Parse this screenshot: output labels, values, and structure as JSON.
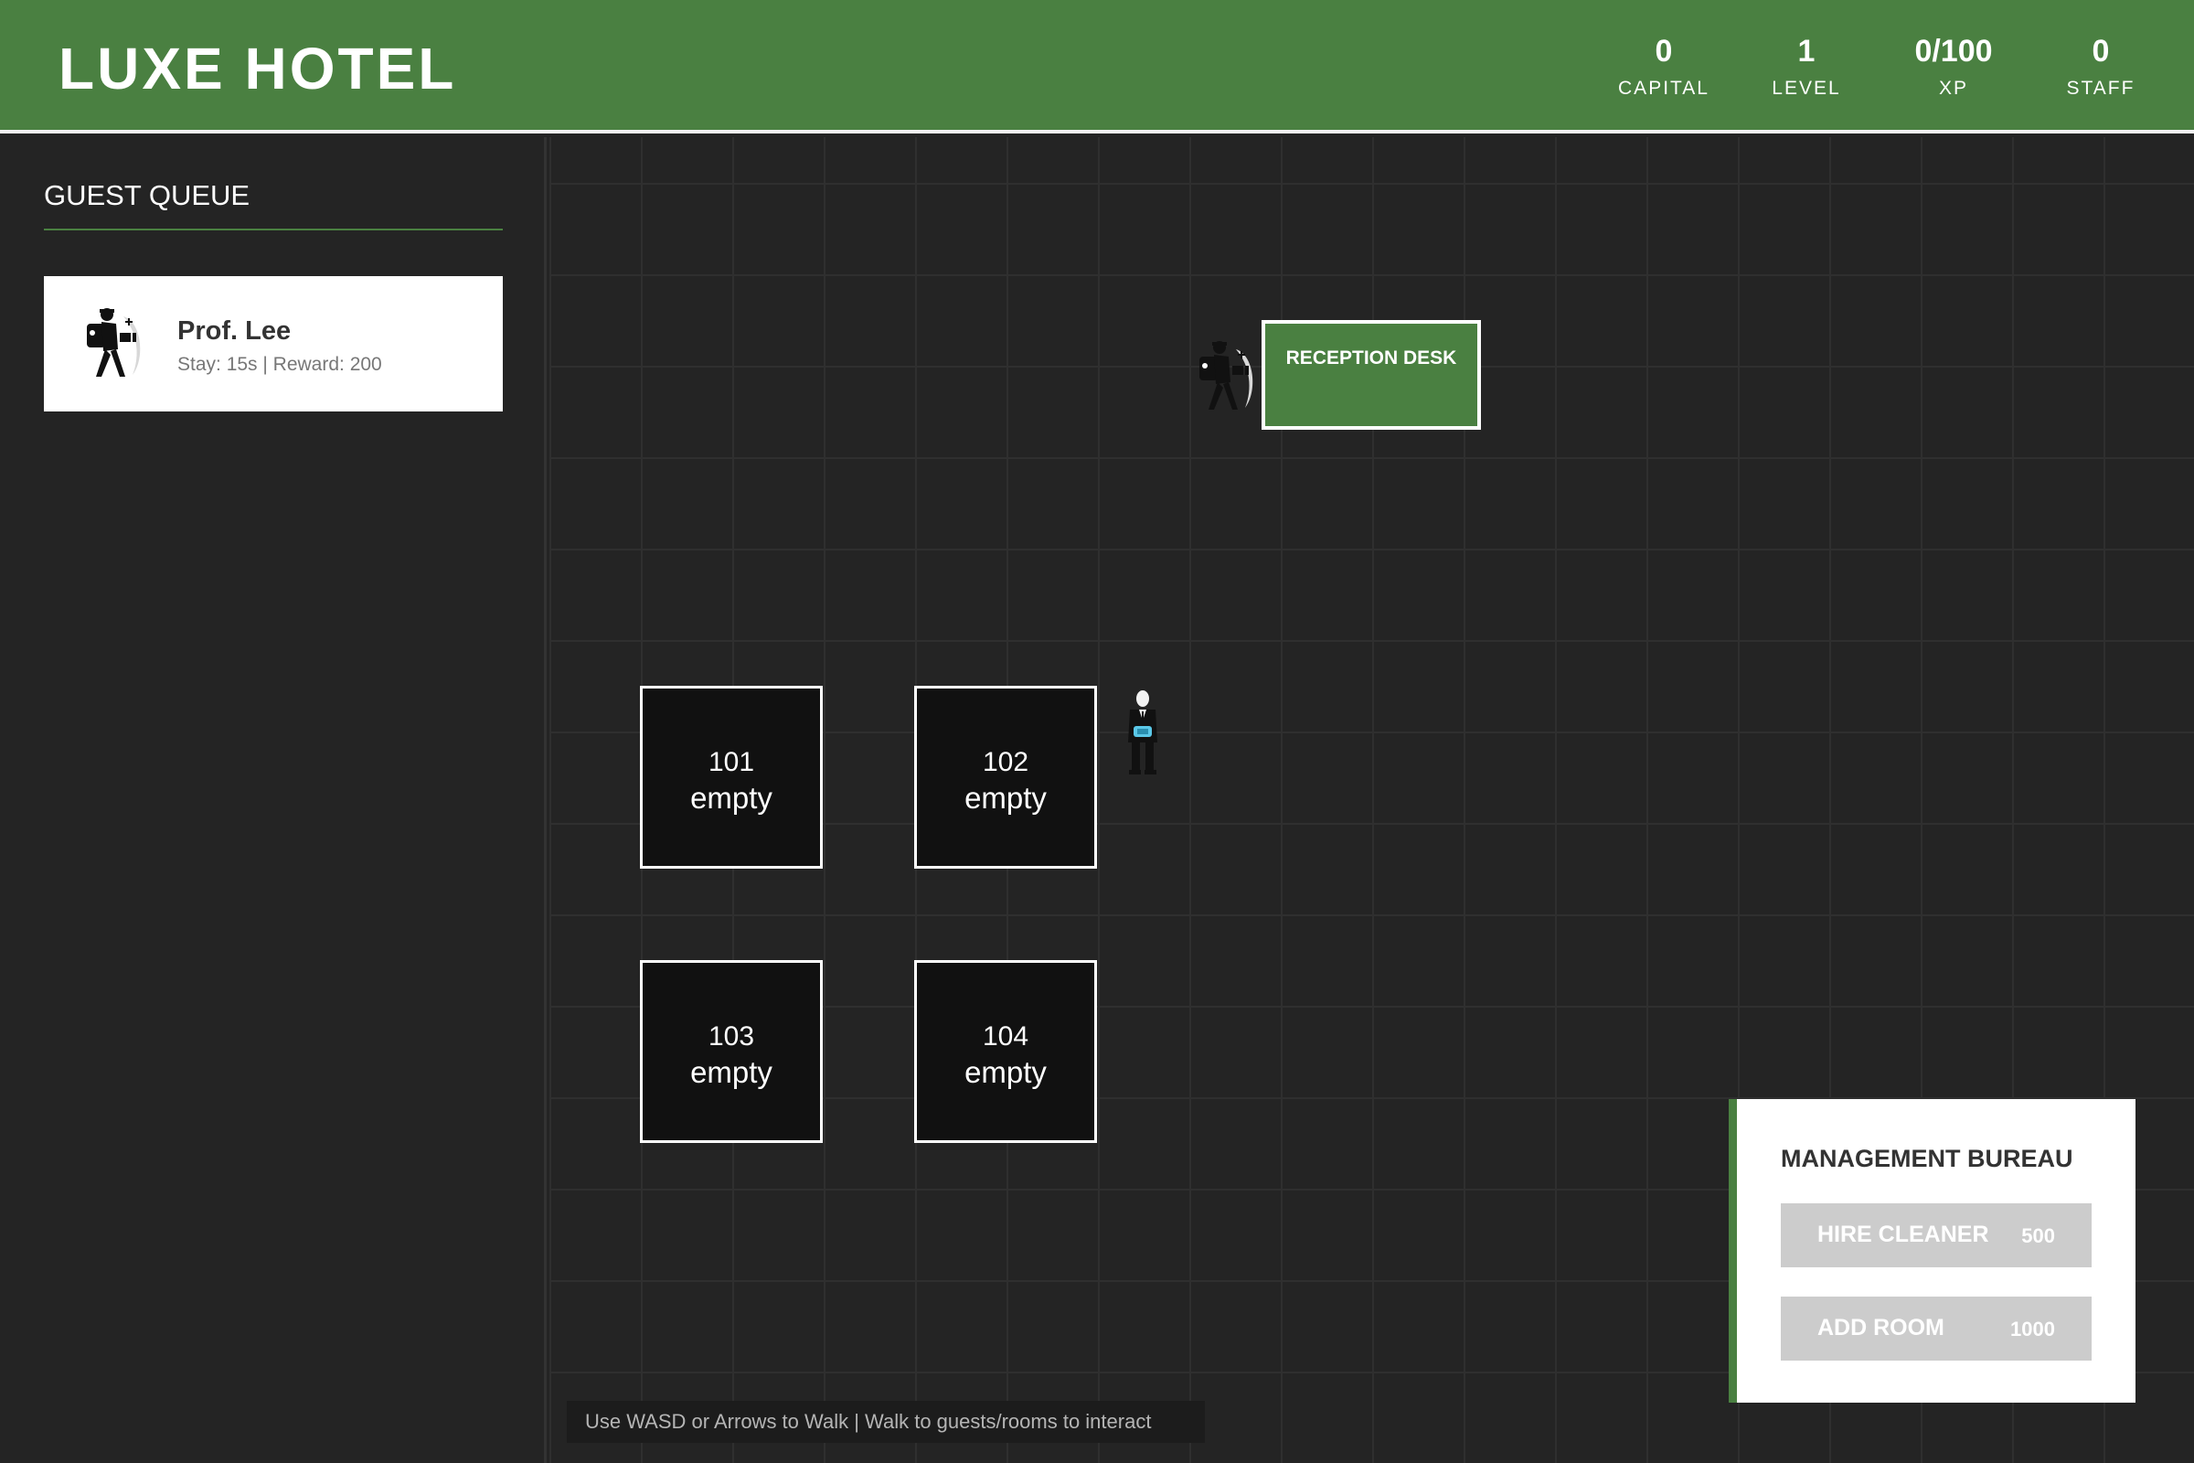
{
  "header": {
    "title": "LUXE HOTEL",
    "stats": [
      {
        "value": "0",
        "label": "CAPITAL"
      },
      {
        "value": "1",
        "label": "LEVEL"
      },
      {
        "value": "0/100",
        "label": "XP"
      },
      {
        "value": "0",
        "label": "STAFF"
      }
    ]
  },
  "sidebar": {
    "title": "GUEST QUEUE",
    "guests": [
      {
        "name": "Prof. Lee",
        "info": "Stay: 15s | Reward: 200",
        "icon": "traveler-icon"
      }
    ]
  },
  "game": {
    "desk_label": "RECEPTION DESK",
    "rooms": [
      {
        "number": "101",
        "status": "empty"
      },
      {
        "number": "102",
        "status": "empty"
      },
      {
        "number": "103",
        "status": "empty"
      },
      {
        "number": "104",
        "status": "empty"
      }
    ],
    "hint": "Use WASD or Arrows to Walk | Walk to guests/rooms to interact"
  },
  "management": {
    "title": "MANAGEMENT BUREAU",
    "buttons": [
      {
        "label": "HIRE CLEANER",
        "cost": "500"
      },
      {
        "label": "ADD ROOM",
        "cost": "1000"
      }
    ]
  },
  "colors": {
    "brand_green": "#4a8041",
    "background": "#242424",
    "room_fill": "#111111",
    "button_disabled": "#cccccc"
  }
}
